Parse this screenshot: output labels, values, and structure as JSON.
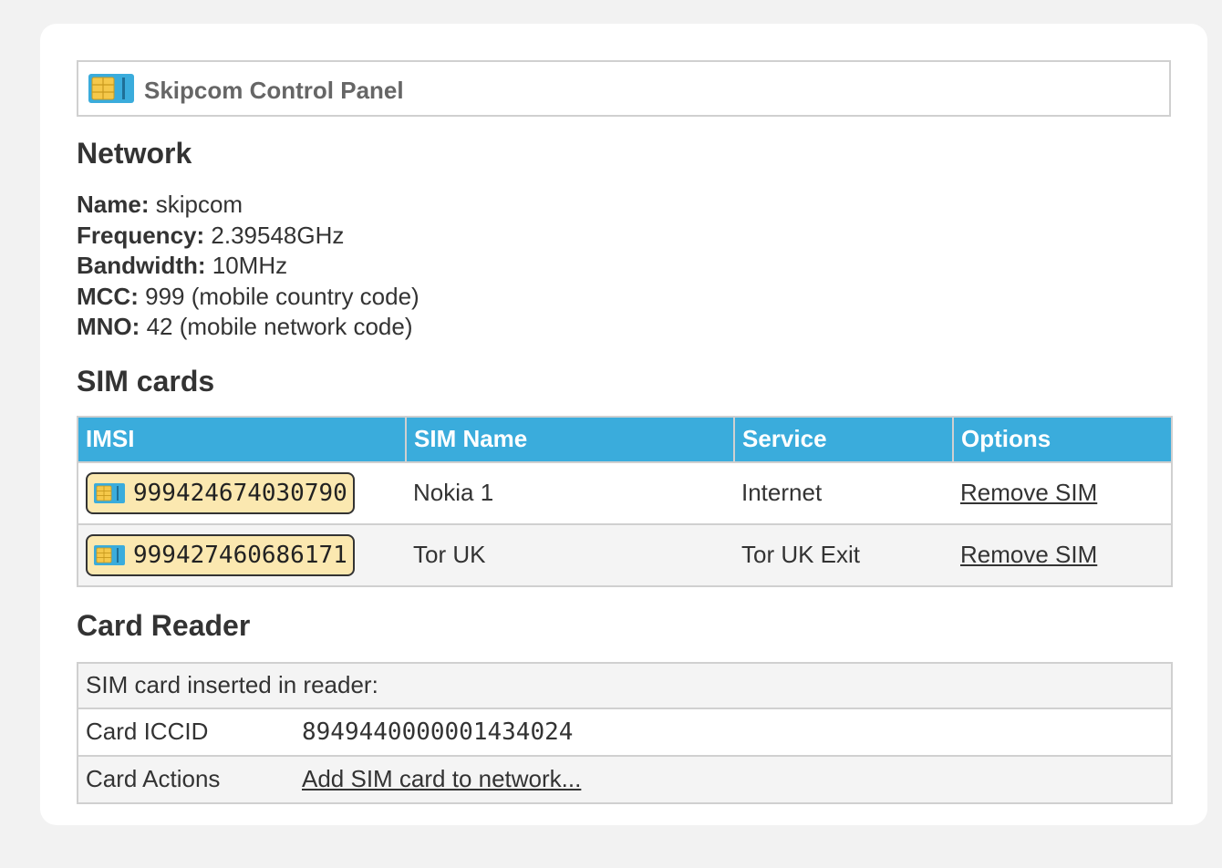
{
  "app": {
    "title": "Skipcom Control Panel"
  },
  "network": {
    "heading": "Network",
    "fields": [
      {
        "label": "Name:",
        "value": "skipcom"
      },
      {
        "label": "Frequency:",
        "value": "2.39548GHz"
      },
      {
        "label": "Bandwidth:",
        "value": "10MHz"
      },
      {
        "label": "MCC:",
        "value": "999 (mobile country code)"
      },
      {
        "label": "MNO:",
        "value": "42 (mobile network code)"
      }
    ]
  },
  "sims": {
    "heading": "SIM cards",
    "columns": [
      "IMSI",
      "SIM Name",
      "Service",
      "Options"
    ],
    "rows": [
      {
        "imsi": "999424674030790",
        "name": "Nokia 1",
        "service": "Internet",
        "action": "Remove SIM"
      },
      {
        "imsi": "999427460686171",
        "name": "Tor UK",
        "service": "Tor UK Exit",
        "action": "Remove SIM"
      }
    ]
  },
  "reader": {
    "heading": "Card Reader",
    "inserted_label": "SIM card inserted in reader:",
    "iccid_label": "Card ICCID",
    "iccid_value": "8949440000001434024",
    "actions_label": "Card Actions",
    "add_link": "Add SIM card to network..."
  },
  "colors": {
    "header_bg": "#3aacdc",
    "badge_bg": "#fbe8b0",
    "icon_card": "#3aacdc",
    "icon_chip": "#f5c84a"
  },
  "icons": {
    "app": "sim-card-icon",
    "imsi": "sim-card-icon"
  }
}
